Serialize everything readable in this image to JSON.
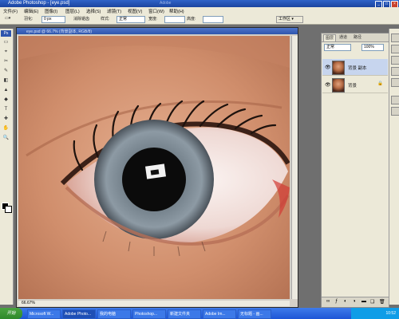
{
  "window": {
    "title_text": "Adobe Photoshop - [eye.psd]",
    "center_text": "Adobe",
    "controls": [
      "_",
      "□",
      "×"
    ]
  },
  "menu": [
    "文件(F)",
    "编辑(E)",
    "图像(I)",
    "图层(L)",
    "选择(S)",
    "滤镜(T)",
    "视图(V)",
    "窗口(W)",
    "帮助(H)"
  ],
  "options": {
    "feather_label": "羽化:",
    "feather_value": "0 px",
    "antialias_label": "消除锯齿",
    "style_label": "样式:",
    "style_value": "正常",
    "width_label": "宽度:",
    "height_label": "高度:",
    "workspace_label": "工作区 ▾"
  },
  "toolbox": {
    "tools": [
      "▭",
      "⌖",
      "✂",
      "✎",
      "◧",
      "▲",
      "◆",
      "T",
      "✚",
      "✋",
      "🔍"
    ]
  },
  "document": {
    "title": "eye.psd @ 66.7% (背景副本, RGB/8)",
    "zoom": "66.67%"
  },
  "layers": {
    "tabs": [
      "图层",
      "通道",
      "路径"
    ],
    "mode_value": "正常",
    "opacity_value": "100%",
    "items": [
      {
        "name": "背景 副本",
        "selected": true,
        "locked": false
      },
      {
        "name": "背景",
        "selected": false,
        "locked": true
      }
    ],
    "footer_icons": [
      "link-icon",
      "fx-icon",
      "mask-icon",
      "adjust-icon",
      "folder-icon",
      "new-layer-icon",
      "trash-icon"
    ]
  },
  "taskbar": {
    "start_label": "开始",
    "tasks": [
      "Microsoft W...",
      "Adobe Photo...",
      "我的电脑",
      "Photoshop...",
      "新建文件夹",
      "Adobe Im...",
      "无标题 - 画..."
    ],
    "clock": "10:52"
  },
  "colors": {
    "title_blue": "#2f63c8",
    "ui_gray": "#ece9d8",
    "taskbar_blue": "#2563e0",
    "selected_layer": "#c7d5ee"
  }
}
